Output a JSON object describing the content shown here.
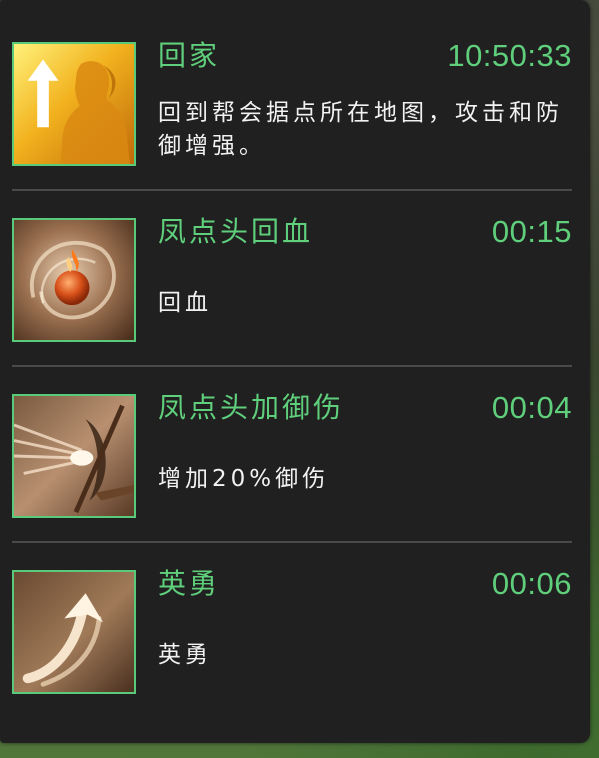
{
  "buffs": [
    {
      "title": "回家",
      "timer": "10:50:33",
      "description": "回到帮会据点所在地图，攻击和防御增强。",
      "icon": "return-home-icon"
    },
    {
      "title": "凤点头回血",
      "timer": "00:15",
      "description": "回血",
      "icon": "fire-orb-icon"
    },
    {
      "title": "凤点头加御伤",
      "timer": "00:04",
      "description": "增加20%御伤",
      "icon": "shield-spear-icon"
    },
    {
      "title": "英勇",
      "timer": "00:06",
      "description": "英勇",
      "icon": "swirl-arrow-icon"
    }
  ],
  "colors": {
    "accent": "#5fcf7c",
    "panel": "#202020",
    "text": "#f2f2f2",
    "divider": "#4a4a4a"
  }
}
